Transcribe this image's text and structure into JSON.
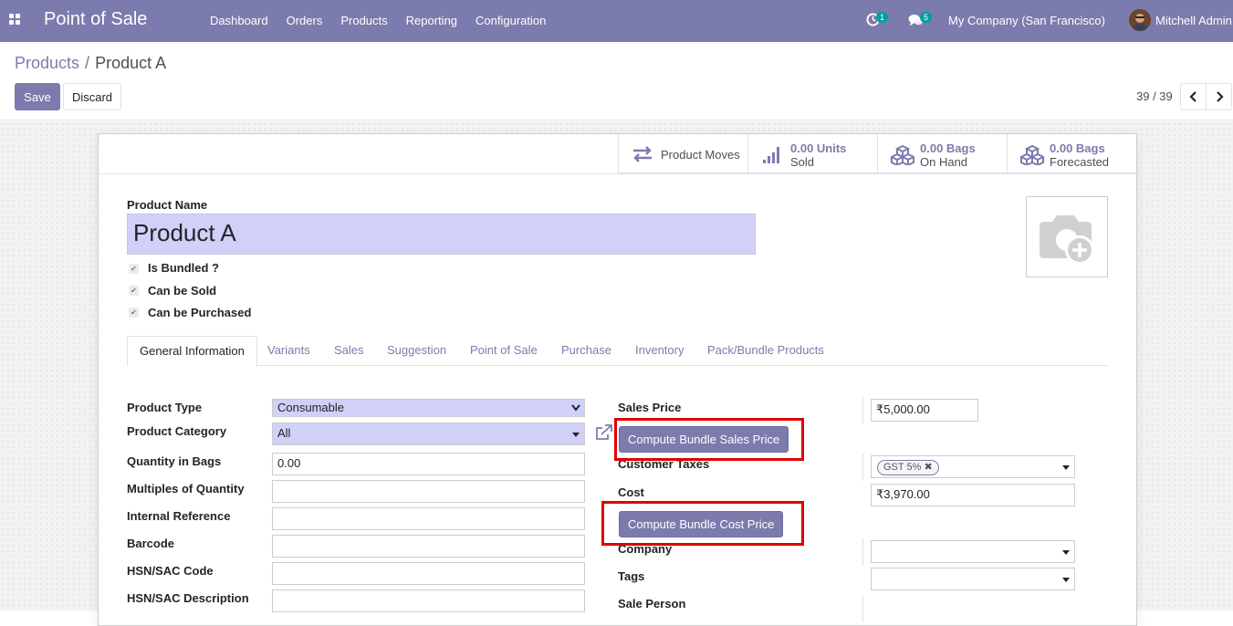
{
  "navbar": {
    "app_name": "Point of Sale",
    "menu": [
      "Dashboard",
      "Orders",
      "Products",
      "Reporting",
      "Configuration"
    ],
    "activity_count": "1",
    "message_count": "5",
    "company": "My Company (San Francisco)",
    "user": "Mitchell Admin",
    "accent": "#7c7bad"
  },
  "breadcrumb": {
    "parent": "Products",
    "separator": "/",
    "current": "Product A"
  },
  "actions": {
    "save": "Save",
    "discard": "Discard"
  },
  "pager": {
    "value": "39 / 39"
  },
  "smart_buttons": {
    "moves": "Product Moves",
    "sold_value": "0.00 Units",
    "sold_label": "Sold",
    "onhand_value": "0.00 Bags",
    "onhand_label": "On Hand",
    "forecast_value": "0.00 Bags",
    "forecast_label": "Forecasted"
  },
  "product": {
    "name_label": "Product Name",
    "name": "Product A",
    "checkboxes": [
      "Is Bundled ?",
      "Can be Sold",
      "Can be Purchased"
    ]
  },
  "tabs": [
    "General Information",
    "Variants",
    "Sales",
    "Suggestion",
    "Point of Sale",
    "Purchase",
    "Inventory",
    "Pack/Bundle Products"
  ],
  "left_fields": {
    "product_type_label": "Product Type",
    "product_type": "Consumable",
    "category_label": "Product Category",
    "category": "All",
    "qty_bags_label": "Quantity in Bags",
    "qty_bags": "0.00",
    "multiples_label": "Multiples of Quantity",
    "internal_ref_label": "Internal Reference",
    "barcode_label": "Barcode",
    "hsn_code_label": "HSN/SAC Code",
    "hsn_desc_label": "HSN/SAC Description"
  },
  "right_fields": {
    "sales_price_label": "Sales Price",
    "sales_price": "₹5,000.00",
    "compute_sales": "Compute Bundle Sales Price",
    "customer_taxes_label": "Customer Taxes",
    "tax_tag": "GST 5%",
    "cost_label": "Cost",
    "cost": "₹3,970.00",
    "compute_cost": "Compute Bundle Cost Price",
    "company_label": "Company",
    "tags_label": "Tags",
    "sale_person_label": "Sale Person"
  }
}
